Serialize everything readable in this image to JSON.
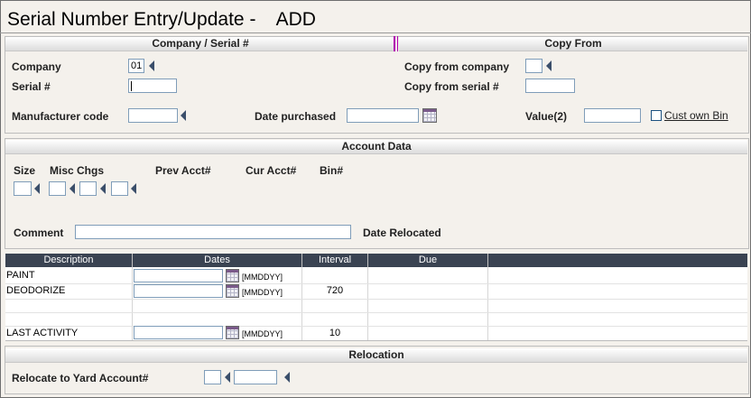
{
  "window": {
    "title": "Serial Number Entry/Update -    ADD"
  },
  "company_serial": {
    "header": "Company / Serial #",
    "company_label": "Company",
    "company_value": "01",
    "serial_label": "Serial #",
    "serial_value": "",
    "manufacturer_label": "Manufacturer code",
    "manufacturer_value": "",
    "date_purchased_label": "Date purchased",
    "date_purchased_value": ""
  },
  "copy_from": {
    "header": "Copy From",
    "company_label": "Copy from company",
    "company_value": "",
    "serial_label": "Copy from serial #",
    "serial_value": "",
    "value_label": "Value(2)",
    "value_value": "",
    "cust_own_bin_label": "Cust own Bin",
    "cust_own_bin_checked": false
  },
  "account_data": {
    "header": "Account Data",
    "size_label": "Size",
    "misc_chgs_label": "Misc Chgs",
    "prev_acct_label": "Prev Acct#",
    "cur_acct_label": "Cur Acct#",
    "bin_label": "Bin#",
    "comment_label": "Comment",
    "comment_value": "",
    "date_relocated_label": "Date Relocated"
  },
  "schedule": {
    "columns": [
      "Description",
      "Dates",
      "Interval",
      "Due"
    ],
    "date_format": "[MMDDYY]",
    "rows": [
      {
        "description": "PAINT",
        "date": "",
        "interval": "",
        "due": ""
      },
      {
        "description": "DEODORIZE",
        "date": "",
        "interval": "720",
        "due": ""
      },
      {
        "description": "",
        "date": "",
        "interval": "",
        "due": ""
      },
      {
        "description": "LAST ACTIVITY",
        "date": "",
        "interval": "10",
        "due": ""
      }
    ]
  },
  "relocation": {
    "header": "Relocation",
    "yard_label": "Relocate to Yard Account#",
    "yard_value_1": "",
    "yard_value_2": ""
  },
  "colors": {
    "grid_header_bg": "#3a4352",
    "arrow": "#3a4e6a",
    "field_border": "#7f9db9"
  }
}
